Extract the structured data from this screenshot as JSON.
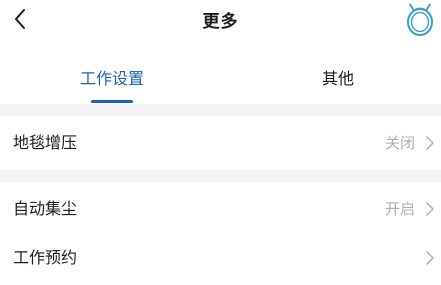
{
  "header": {
    "title": "更多",
    "back_icon": "chevron-left-icon",
    "robot_icon": "robot-vacuum-icon"
  },
  "tabs": [
    {
      "label": "工作设置",
      "active": true
    },
    {
      "label": "其他",
      "active": false
    }
  ],
  "settings": [
    {
      "label": "地毯增压",
      "value": "关闭"
    },
    {
      "label": "自动集尘",
      "value": "开启"
    },
    {
      "label": "工作预约",
      "value": ""
    }
  ],
  "colors": {
    "accent": "#1d63b8",
    "robot_icon": "#3a9fc4",
    "secondary_text": "#b0b0b0",
    "section_gap": "#f4f4f6"
  }
}
